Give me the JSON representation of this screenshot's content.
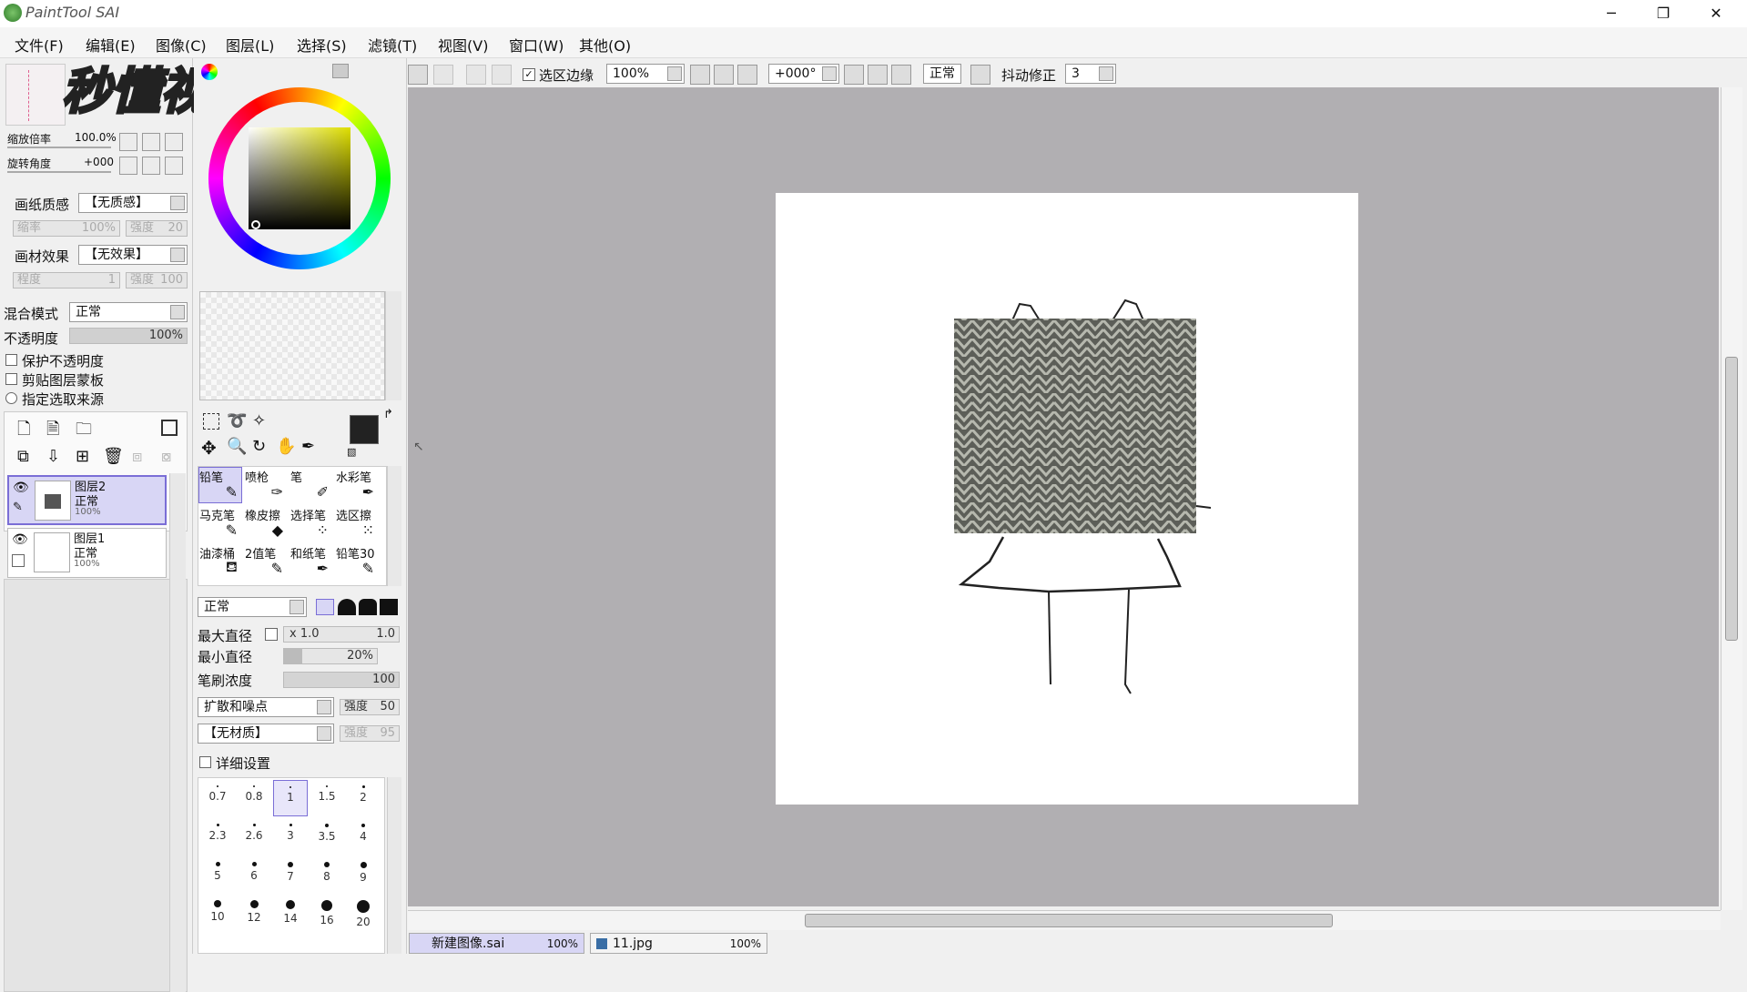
{
  "app": {
    "logo_text": "PaintTool SAI",
    "watermark": "秒懂视频"
  },
  "window": {
    "minimize": "─",
    "restore": "❐",
    "close": "✕"
  },
  "menu": [
    "文件(F)",
    "编辑(E)",
    "图像(C)",
    "图层(L)",
    "选择(S)",
    "滤镜(T)",
    "视图(V)",
    "窗口(W)",
    "其他(O)"
  ],
  "navigator": {
    "zoom_label": "缩放倍率",
    "zoom_value": "100.0%",
    "rotate_label": "旋转角度",
    "rotate_value": "+000"
  },
  "paper": {
    "texture_label": "画纸质感",
    "texture_value": "【无质感】",
    "scale_label": "缩率",
    "scale_value": "100%",
    "strength_label": "强度",
    "strength_value": "20",
    "effect_label": "画材效果",
    "effect_value": "【无效果】",
    "degree_label": "程度",
    "degree_value": "1",
    "strength2_label": "强度",
    "strength2_value": "100"
  },
  "layer_props": {
    "blend_label": "混合模式",
    "blend_value": "正常",
    "opacity_label": "不透明度",
    "opacity_value": "100%",
    "opacity": 1.0,
    "protect": "保护不透明度",
    "clip": "剪贴图层蒙板",
    "source": "指定选取来源"
  },
  "layers": [
    {
      "name": "图层2",
      "mode": "正常",
      "opacity": "100%"
    },
    {
      "name": "图层1",
      "mode": "正常",
      "opacity": "100%"
    }
  ],
  "tools": {
    "names": [
      "铅笔",
      "喷枪",
      "笔",
      "水彩笔",
      "马克笔",
      "橡皮擦",
      "选择笔",
      "选区擦",
      "油漆桶",
      "2值笔",
      "和纸笔",
      "铅笔30"
    ]
  },
  "brush": {
    "mode": "正常",
    "max_size_label": "最大直径",
    "max_size_mult": "x 1.0",
    "max_size_value": "1.0",
    "min_size_label": "最小直径",
    "min_size_value": "20%",
    "min_size": 0.2,
    "density_label": "笔刷浓度",
    "density_value": "100",
    "density": 1.0,
    "shape": "扩散和噪点",
    "shape_strength_label": "强度",
    "shape_strength_value": "50",
    "texture": "【无材质】",
    "texture_strength_label": "强度",
    "texture_strength_value": "95",
    "detail": "详细设置"
  },
  "brush_sizes": [
    "0.7",
    "0.8",
    "1",
    "1.5",
    "2",
    "2.3",
    "2.6",
    "3",
    "3.5",
    "4",
    "5",
    "6",
    "7",
    "8",
    "9",
    "10",
    "12",
    "14",
    "16",
    "20"
  ],
  "toolbar": {
    "selection_edge": "选区边缘",
    "zoom": "100%",
    "rotation": "+000°",
    "mode": "正常",
    "stabilizer_label": "抖动修正",
    "stabilizer_value": "3"
  },
  "tabs": [
    {
      "name": "新建图像.sai",
      "zoom": "100%"
    },
    {
      "name": "11.jpg",
      "zoom": "100%"
    }
  ],
  "colors": {
    "accent": "#7a6ed6",
    "canvas_bg": "#b1afb2"
  }
}
